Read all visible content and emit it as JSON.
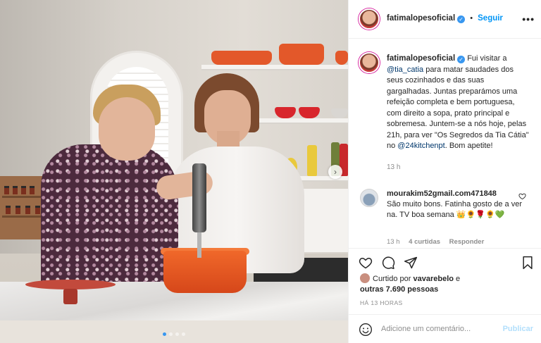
{
  "post": {
    "username": "fatimalopesoficial",
    "follow_label": "Seguir",
    "more_label": "•••",
    "verified_mark": "✓",
    "caption_text_1": "Fui visitar a ",
    "caption_mention_1": "@tia_catia",
    "caption_text_2": " para matar saudades dos seus cozinhados e das suas gargalhadas. Juntas preparámos uma refeição completa e bem portuguesa, com direito a sopa, prato principal e sobremesa. Juntem-se a nós hoje, pelas 21h, para ver \"Os Segredos da Tia Cátia\" no ",
    "caption_mention_2": "@24kitchenpt",
    "caption_text_3": ". Bom apetite!",
    "caption_time": "13 h",
    "carousel_total": 4,
    "carousel_active": 1,
    "next_arrow": "›"
  },
  "comment": {
    "username": "mourakim52gmail.com471848",
    "text": "São muito bons. Fatinha gosto de a ver na. TV boa semana 👑🌻🌹🌻💚",
    "time": "13 h",
    "likes": "4 curtidas",
    "reply_label": "Responder"
  },
  "likes": {
    "prefix": "Curtido por ",
    "liker": "vavarebelo",
    "connector": " e",
    "others": "outras 7.690 pessoas"
  },
  "timestamp": "HÁ 13 HORAS",
  "add_comment": {
    "placeholder": "Adicione um comentário...",
    "publish_label": "Publicar"
  },
  "colors": {
    "accent": "#0095f6",
    "verified": "#3897f0",
    "muted": "#8e8e8e",
    "publish_disabled": "#b2dffc"
  },
  "icons": [
    "heart-icon",
    "comment-icon",
    "share-icon",
    "bookmark-icon",
    "emoji-icon",
    "more-icon",
    "verified-icon"
  ]
}
